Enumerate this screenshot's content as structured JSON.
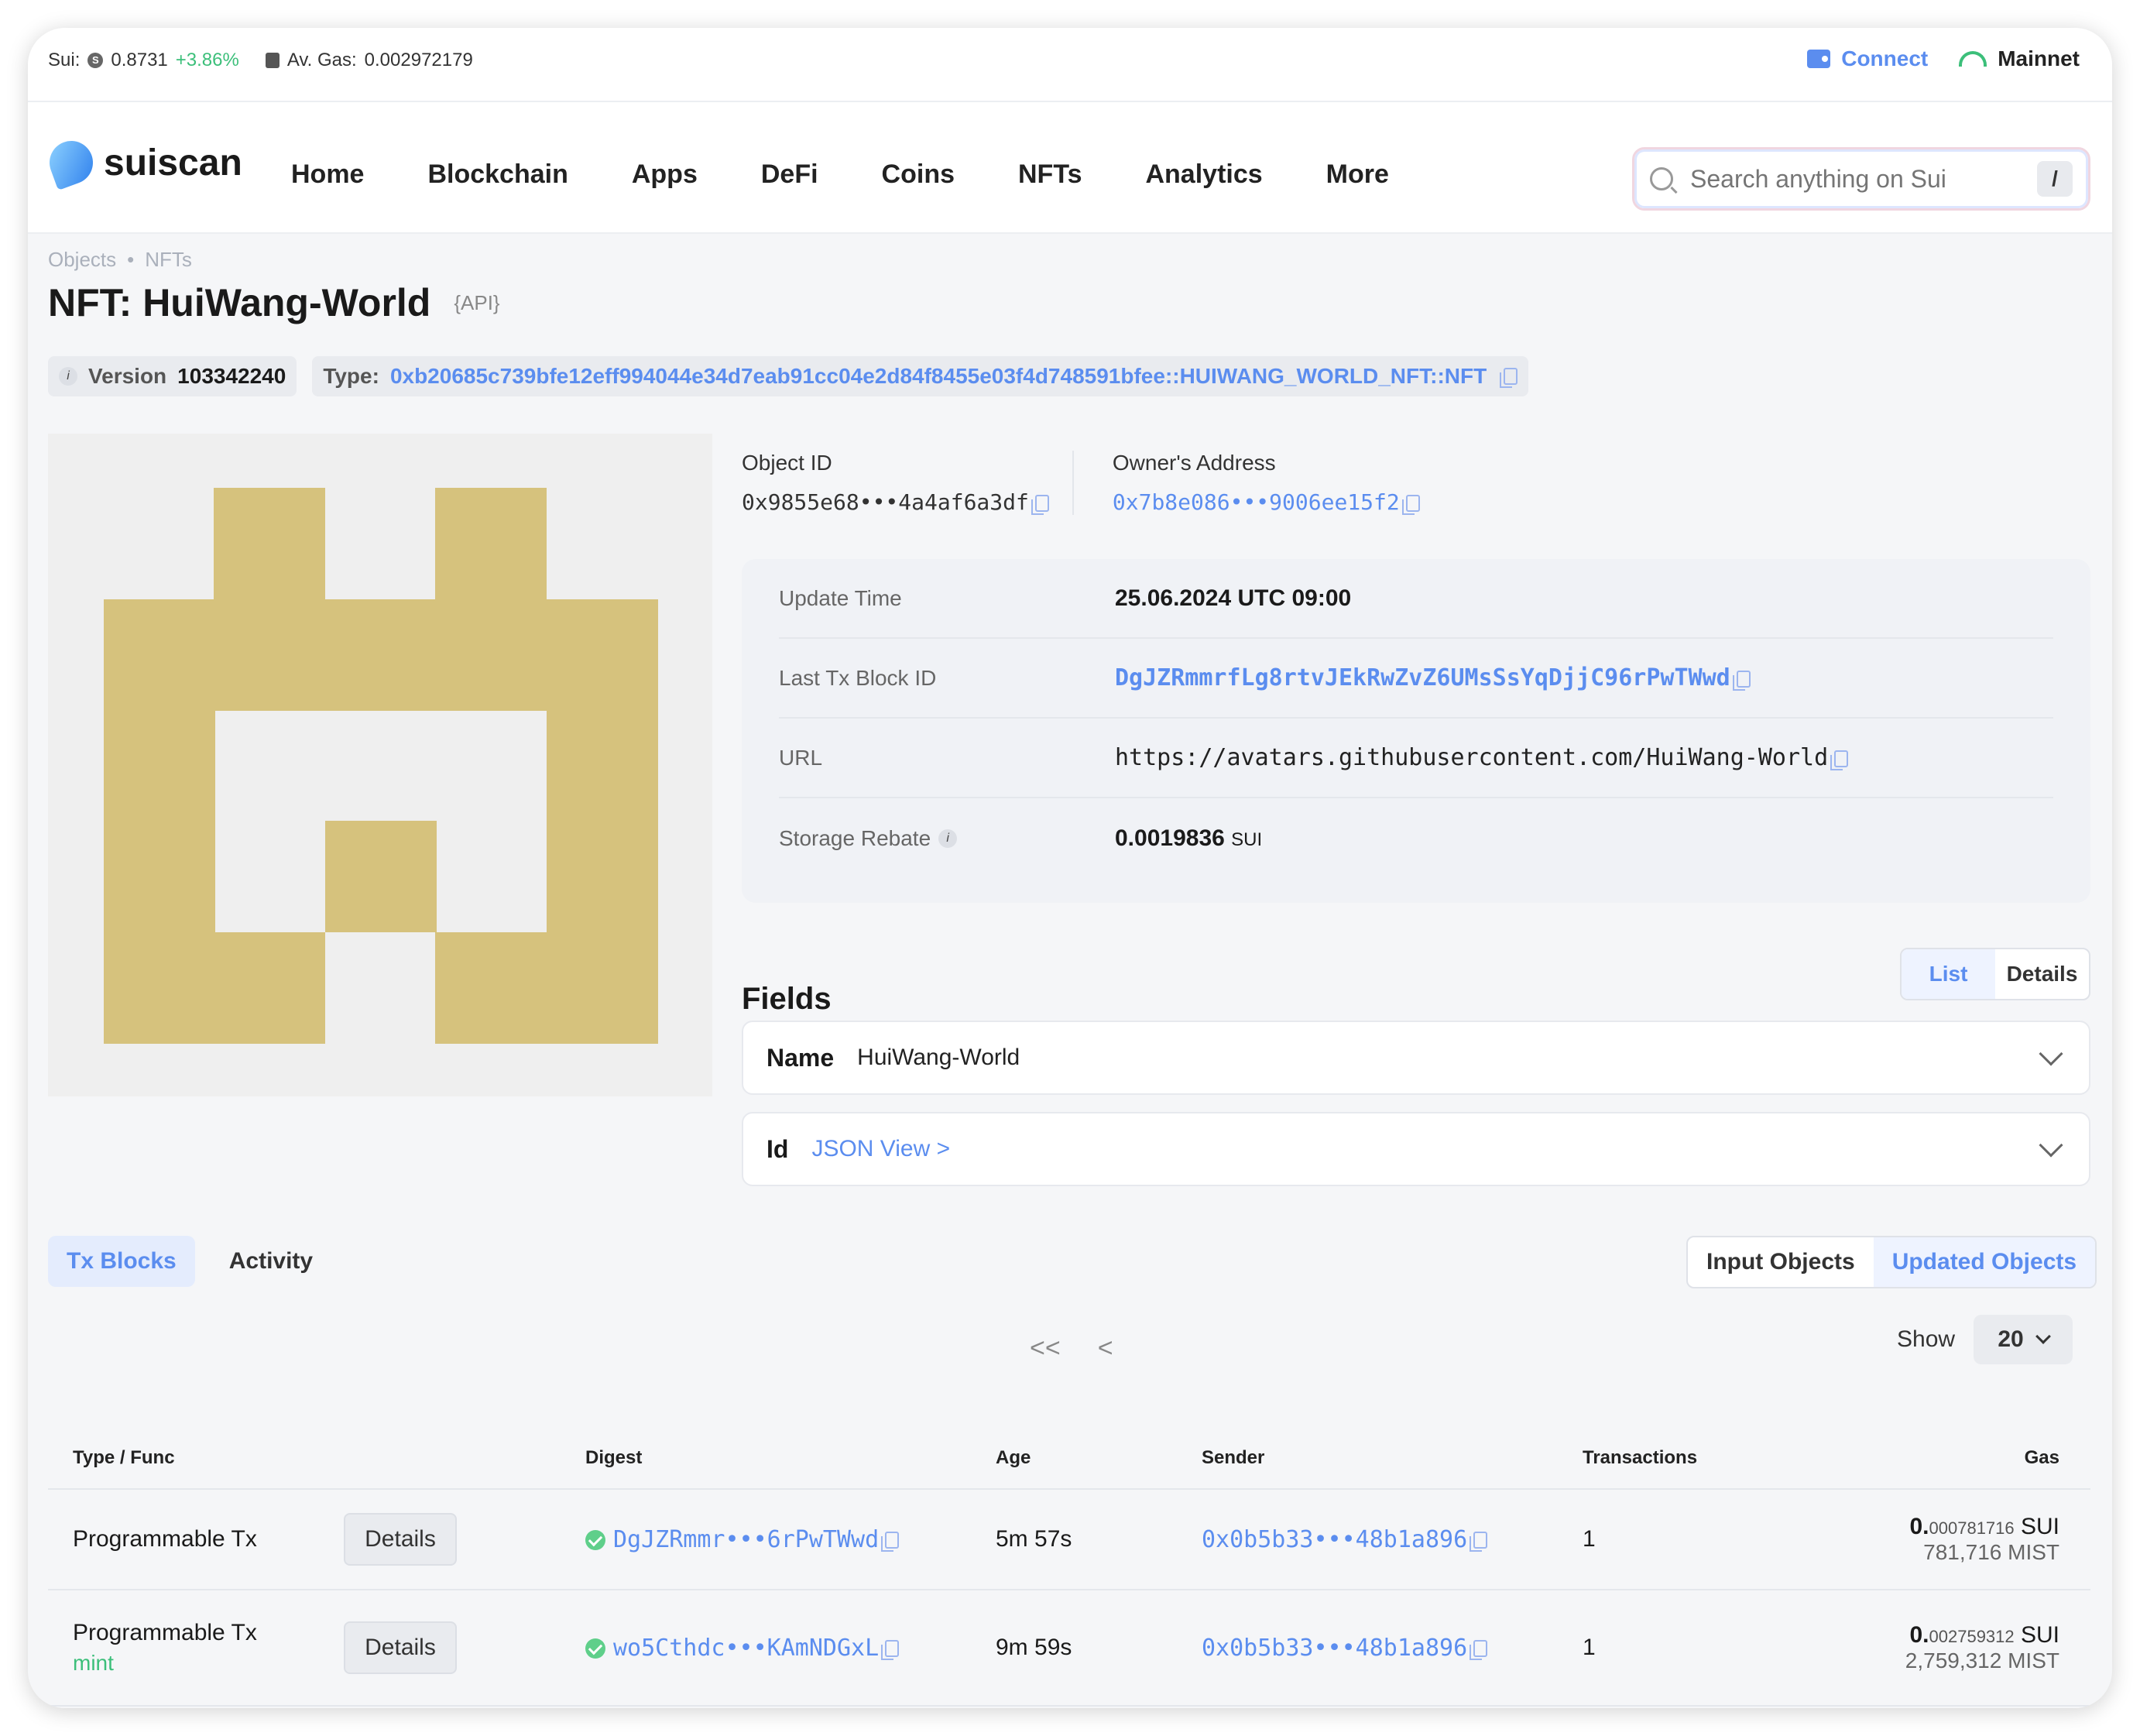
{
  "ticker": {
    "sui_label": "Sui:",
    "sui_price": "0.8731",
    "sui_change": "+3.86%",
    "gas_label": "Av. Gas:",
    "gas_value": "0.002972179"
  },
  "top_actions": {
    "connect": "Connect",
    "network": "Mainnet"
  },
  "brand": {
    "name": "suiscan"
  },
  "nav": [
    "Home",
    "Blockchain",
    "Apps",
    "DeFi",
    "Coins",
    "NFTs",
    "Analytics",
    "More"
  ],
  "search": {
    "placeholder": "Search anything on Sui",
    "shortcut": "/"
  },
  "breadcrumb": [
    "Objects",
    "NFTs"
  ],
  "page": {
    "title": "NFT: HuiWang-World",
    "api_tag": "{API}"
  },
  "meta": {
    "version_label": "Version",
    "version": "103342240",
    "type_label": "Type:",
    "type": "0xb20685c739bfe12eff994044e34d7eab91cc04e2d84f8455e03f4d748591bfee::HUIWANG_WORLD_NFT::NFT"
  },
  "object": {
    "id_label": "Object ID",
    "id": "0x9855e68•••4a4af6a3df",
    "owner_label": "Owner's Address",
    "owner": "0x7b8e086•••9006ee15f2"
  },
  "details": [
    {
      "label": "Update Time",
      "value": "25.06.2024 UTC 09:00"
    },
    {
      "label": "Last Tx Block ID",
      "value": "DgJZRmmrfLg8rtvJEkRwZvZ6UMsSsYqDjjC96rPwTWwd"
    },
    {
      "label": "URL",
      "value": "https://avatars.githubusercontent.com/HuiWang-World"
    },
    {
      "label": "Storage Rebate",
      "value": "0.0019836",
      "unit": "SUI"
    }
  ],
  "fields": {
    "title": "Fields",
    "view_options": [
      "List",
      "Details"
    ],
    "rows": [
      {
        "key": "Name",
        "value": "HuiWang-World"
      },
      {
        "key": "Id",
        "value": "JSON View >"
      }
    ]
  },
  "tabs": [
    "Tx Blocks",
    "Activity"
  ],
  "object_filter": [
    "Input Objects",
    "Updated Objects"
  ],
  "pager": {
    "first": "<<",
    "prev": "<",
    "show_label": "Show",
    "page_size": "20"
  },
  "table": {
    "headers": [
      "Type / Func",
      "Digest",
      "Age",
      "Sender",
      "Transactions",
      "Gas"
    ],
    "rows": [
      {
        "type": "Programmable Tx",
        "func": "",
        "action": "Details",
        "digest": "DgJZRmmr•••6rPwTWwd",
        "age": "5m 57s",
        "sender": "0x0b5b33•••48b1a896",
        "transactions": "1",
        "gas_int": "0.",
        "gas_dec": "000781716",
        "gas_unit": "SUI",
        "gas_mist": "781,716 MIST"
      },
      {
        "type": "Programmable Tx",
        "func": "mint",
        "action": "Details",
        "digest": "wo5Cthdc•••KAmNDGxL",
        "age": "9m 59s",
        "sender": "0x0b5b33•••48b1a896",
        "transactions": "1",
        "gas_int": "0.",
        "gas_dec": "002759312",
        "gas_unit": "SUI",
        "gas_mist": "2,759,312 MIST"
      }
    ]
  },
  "colors": {
    "accent": "#5b8def",
    "positive": "#3cbf7a",
    "nft_gold": "#d6c27d"
  }
}
